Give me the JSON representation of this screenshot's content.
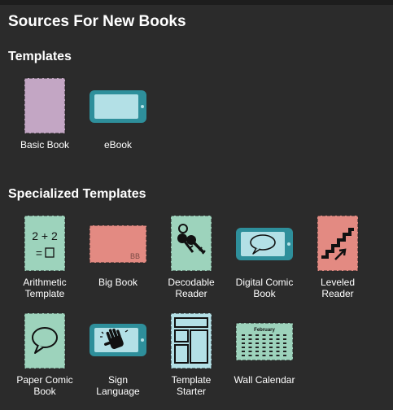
{
  "page": {
    "title": "Sources For New Books"
  },
  "sections": [
    {
      "title": "Templates",
      "items": [
        {
          "label": "Basic Book",
          "icon": "basic-book-icon"
        },
        {
          "label": "eBook",
          "icon": "tablet-icon"
        }
      ]
    },
    {
      "title": "Specialized Templates",
      "items": [
        {
          "label": "Arithmetic\nTemplate",
          "icon": "arithmetic-icon",
          "glyph_line1": "2 + 2",
          "glyph_line2": "="
        },
        {
          "label": "Big Book",
          "icon": "big-book-icon",
          "glyph": "BB"
        },
        {
          "label": "Decodable\nReader",
          "icon": "keys-icon"
        },
        {
          "label": "Digital Comic\nBook",
          "icon": "tablet-speech-bubble-icon"
        },
        {
          "label": "Leveled\nReader",
          "icon": "stairs-icon"
        },
        {
          "label": "Paper Comic\nBook",
          "icon": "speech-bubble-icon"
        },
        {
          "label": "Sign\nLanguage",
          "icon": "sign-hand-icon"
        },
        {
          "label": "Template\nStarter",
          "icon": "template-layout-icon"
        },
        {
          "label": "Wall Calendar",
          "icon": "calendar-icon",
          "glyph": "February"
        }
      ]
    }
  ],
  "colors": {
    "background": "#2b2b2b",
    "lavender": "#c3a6c4",
    "teal": "#2e8f9b",
    "light_blue": "#b3e0e6",
    "mint": "#9dd3bc",
    "salmon": "#e38a82"
  }
}
